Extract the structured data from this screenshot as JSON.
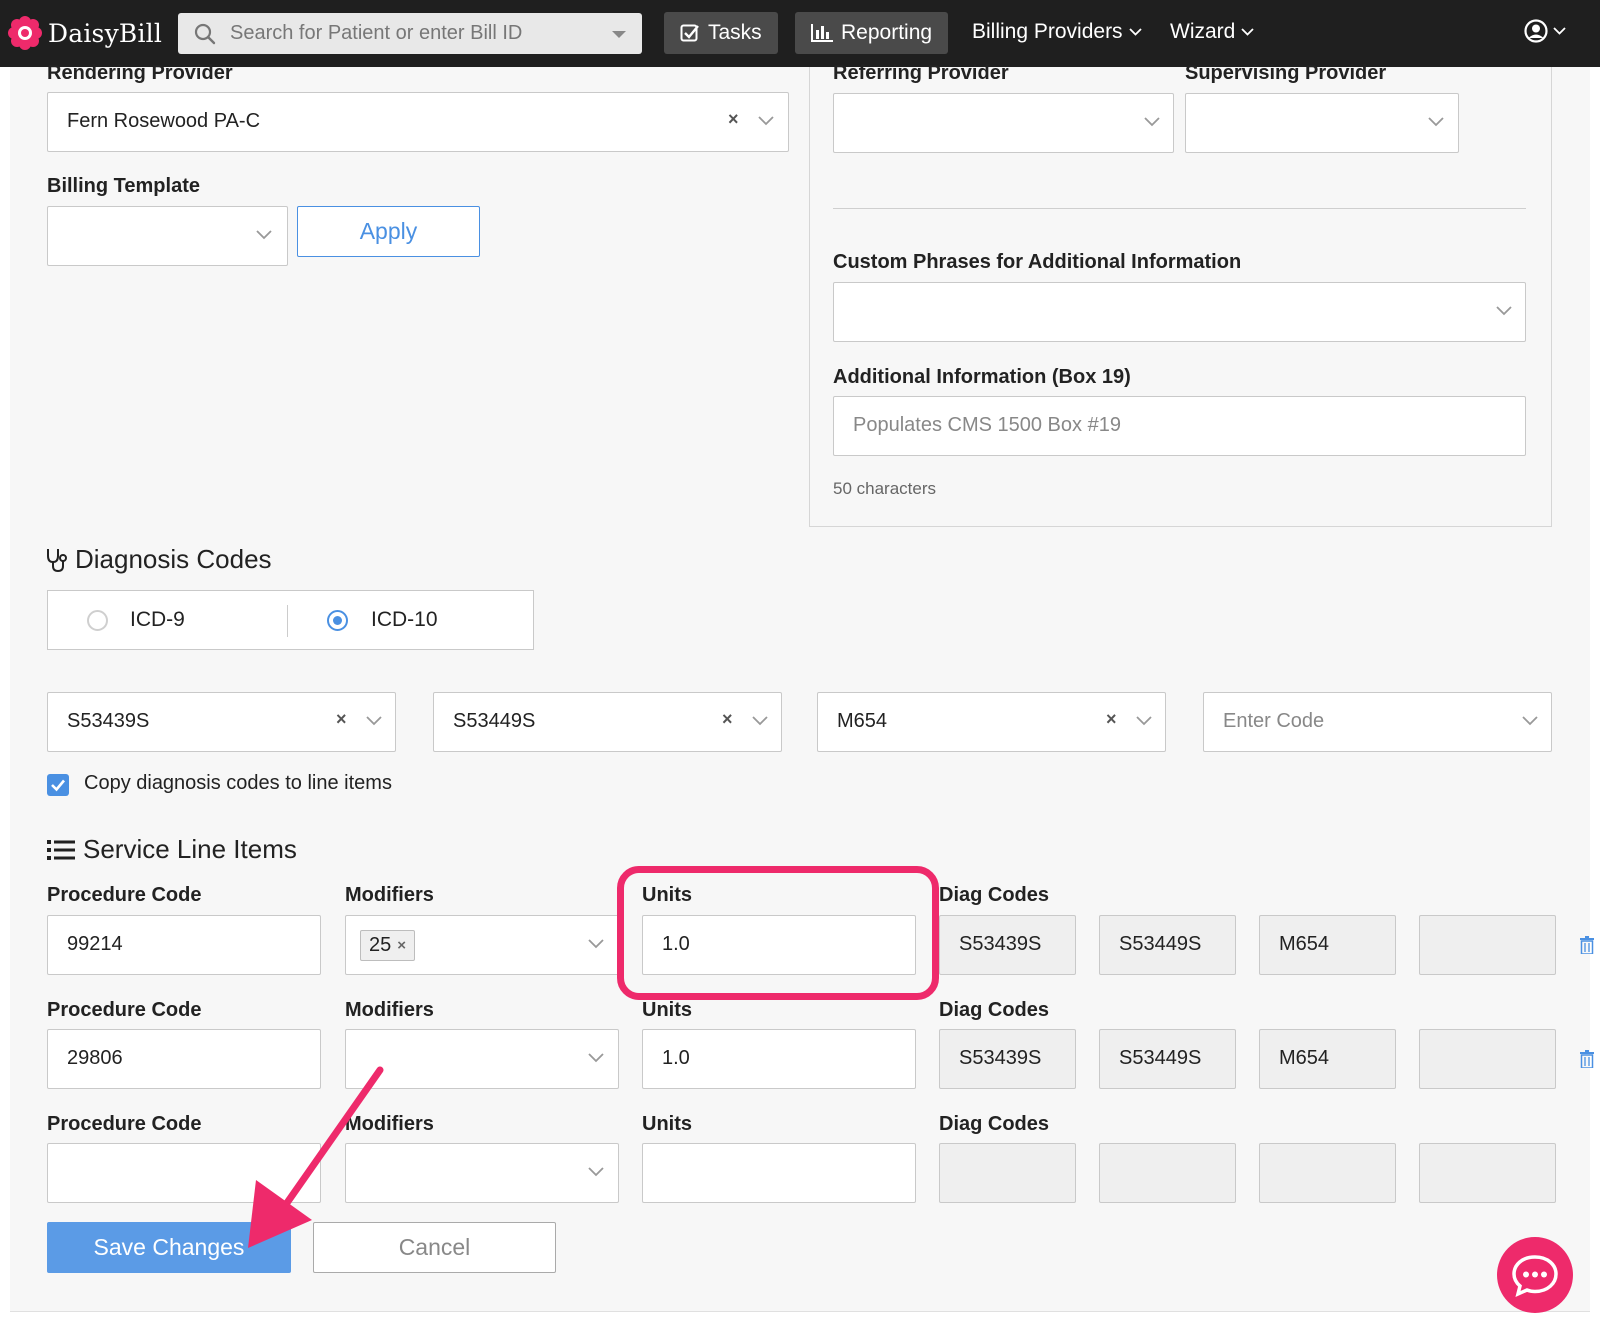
{
  "navbar": {
    "brand": "DaisyBill",
    "search_placeholder": "Search for Patient or enter Bill ID",
    "tasks": "Tasks",
    "reporting": "Reporting",
    "billing_providers": "Billing Providers",
    "wizard": "Wizard"
  },
  "provider": {
    "rendering_label": "Rendering Provider",
    "rendering_value": "Fern Rosewood PA-C",
    "billing_template_label": "Billing Template",
    "apply": "Apply",
    "referring_label": "Referring Provider",
    "supervising_label": "Supervising Provider",
    "custom_phrases_label": "Custom Phrases for Additional Information",
    "additional_info_label": "Additional Information (Box 19)",
    "additional_info_placeholder": "Populates CMS 1500 Box #19",
    "char_hint": "50 characters"
  },
  "diagnosis": {
    "title": "Diagnosis Codes",
    "options": [
      "ICD-9",
      "ICD-10"
    ],
    "selected": "ICD-10",
    "codes": [
      "S53439S",
      "S53449S",
      "M654"
    ],
    "enter_code_placeholder": "Enter Code",
    "copy_label": "Copy diagnosis codes to line items",
    "copy_checked": true
  },
  "service_lines": {
    "title": "Service Line Items",
    "col_procedure": "Procedure Code",
    "col_modifiers": "Modifiers",
    "col_units": "Units",
    "col_diag": "Diag Codes",
    "rows": [
      {
        "procedure": "99214",
        "modifier": "25",
        "units": "1.0",
        "diag": [
          "S53439S",
          "S53449S",
          "M654",
          ""
        ]
      },
      {
        "procedure": "29806",
        "modifier": "",
        "units": "1.0",
        "diag": [
          "S53439S",
          "S53449S",
          "M654",
          ""
        ]
      },
      {
        "procedure": "",
        "modifier": "",
        "units": "",
        "diag": [
          "",
          "",
          "",
          ""
        ]
      }
    ]
  },
  "actions": {
    "save": "Save Changes",
    "cancel": "Cancel"
  },
  "colors": {
    "accent": "#4a90e2",
    "annotation": "#ee2a6b",
    "navbar": "#1f1f1f"
  }
}
